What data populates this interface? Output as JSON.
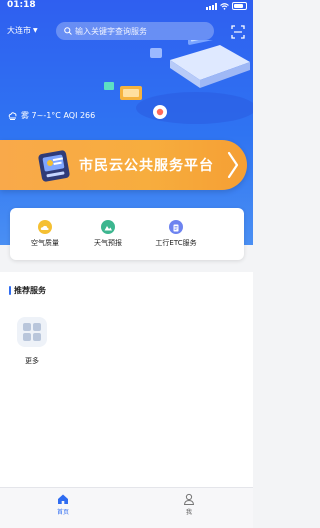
{
  "status_bar": {
    "time": "01:18"
  },
  "header": {
    "city": "大连市",
    "search_placeholder": "输入关键字查询服务"
  },
  "weather": {
    "text": "雾 7~-1°C AQI 266"
  },
  "banner": {
    "title": "市民云公共服务平台"
  },
  "quick_actions": [
    {
      "label": "空气质量",
      "icon": "cloud-icon",
      "color": "#f5c032"
    },
    {
      "label": "天气预报",
      "icon": "weather-icon",
      "color": "#3cb68f"
    },
    {
      "label": "工行ETC服务",
      "icon": "document-icon",
      "color": "#6d83f0"
    }
  ],
  "recommended": {
    "title": "推荐服务",
    "items": [
      {
        "label": "更多",
        "icon": "grid-icon"
      }
    ]
  },
  "tabbar": {
    "tabs": [
      {
        "label": "首页",
        "icon": "home-icon",
        "active": true
      },
      {
        "label": "我",
        "icon": "user-icon",
        "active": false
      }
    ]
  },
  "colors": {
    "primary": "#2f6cf1",
    "banner": "#f7ad3e"
  }
}
